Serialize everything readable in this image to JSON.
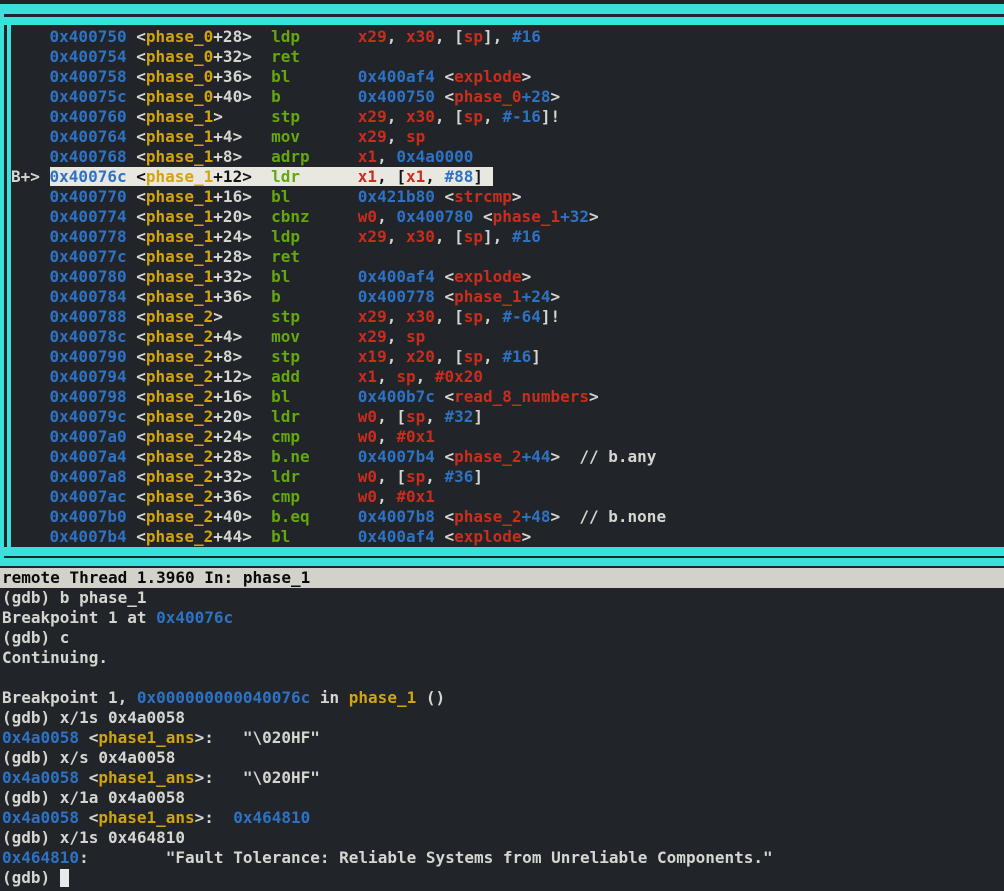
{
  "palette": {
    "background": "#212429",
    "border_cyan": "#38e1d9",
    "text_plain": "#d6d6d1",
    "text_address_blue": "#2e72c4",
    "text_symbol_gold": "#d2a40e",
    "text_mnemonic_green": "#63a80d",
    "text_register_red": "#c92d1d",
    "current_line_bg": "#e8e8e1",
    "status_bar_bg": "#d2d2cb",
    "status_bar_fg": "#0a0a0a"
  },
  "disasm_window": {
    "breakpoint_marker": "B+>",
    "rows": [
      {
        "addr": "0x400750",
        "sym": "phase_0",
        "off": "+28",
        "mnemonic": "ldp",
        "operands": [
          [
            "x29",
            "r"
          ],
          [
            ", ",
            "p"
          ],
          [
            "x30",
            "r"
          ],
          [
            ", [",
            "p"
          ],
          [
            "sp",
            "r"
          ],
          [
            "], ",
            "p"
          ],
          [
            "#16",
            "b"
          ]
        ]
      },
      {
        "addr": "0x400754",
        "sym": "phase_0",
        "off": "+32",
        "mnemonic": "ret",
        "operands": []
      },
      {
        "addr": "0x400758",
        "sym": "phase_0",
        "off": "+36",
        "mnemonic": "bl",
        "operands": [
          [
            "0x400af4",
            "b"
          ],
          [
            " <",
            "p"
          ],
          [
            "explode",
            "r"
          ],
          [
            ">",
            "p"
          ]
        ]
      },
      {
        "addr": "0x40075c",
        "sym": "phase_0",
        "off": "+40",
        "mnemonic": "b",
        "operands": [
          [
            "0x400750",
            "b"
          ],
          [
            " <",
            "p"
          ],
          [
            "phase_0",
            "r"
          ],
          [
            "+28",
            "b"
          ],
          [
            ">",
            "p"
          ]
        ]
      },
      {
        "addr": "0x400760",
        "sym": "phase_1",
        "off": "",
        "mnemonic": "stp",
        "operands": [
          [
            "x29",
            "r"
          ],
          [
            ", ",
            "p"
          ],
          [
            "x30",
            "r"
          ],
          [
            ", [",
            "p"
          ],
          [
            "sp",
            "r"
          ],
          [
            ", ",
            "p"
          ],
          [
            "#-16",
            "b"
          ],
          [
            "]!",
            "p"
          ]
        ]
      },
      {
        "addr": "0x400764",
        "sym": "phase_1",
        "off": "+4",
        "mnemonic": "mov",
        "operands": [
          [
            "x29",
            "r"
          ],
          [
            ", ",
            "p"
          ],
          [
            "sp",
            "r"
          ]
        ]
      },
      {
        "addr": "0x400768",
        "sym": "phase_1",
        "off": "+8",
        "mnemonic": "adrp",
        "operands": [
          [
            "x1",
            "r"
          ],
          [
            ", ",
            "p"
          ],
          [
            "0x4a0000",
            "b"
          ]
        ]
      },
      {
        "addr": "0x40076c",
        "sym": "phase_1",
        "off": "+12",
        "mnemonic": "ldr",
        "current": true,
        "operands": [
          [
            "x1",
            "r"
          ],
          [
            ", [",
            "p"
          ],
          [
            "x1",
            "r"
          ],
          [
            ", ",
            "p"
          ],
          [
            "#88",
            "b"
          ],
          [
            "]",
            "p"
          ]
        ]
      },
      {
        "addr": "0x400770",
        "sym": "phase_1",
        "off": "+16",
        "mnemonic": "bl",
        "operands": [
          [
            "0x421b80",
            "b"
          ],
          [
            " <",
            "p"
          ],
          [
            "strcmp",
            "r"
          ],
          [
            ">",
            "p"
          ]
        ]
      },
      {
        "addr": "0x400774",
        "sym": "phase_1",
        "off": "+20",
        "mnemonic": "cbnz",
        "operands": [
          [
            "w0",
            "r"
          ],
          [
            ", ",
            "p"
          ],
          [
            "0x400780",
            "b"
          ],
          [
            " <",
            "p"
          ],
          [
            "phase_1",
            "r"
          ],
          [
            "+32",
            "b"
          ],
          [
            ">",
            "p"
          ]
        ]
      },
      {
        "addr": "0x400778",
        "sym": "phase_1",
        "off": "+24",
        "mnemonic": "ldp",
        "operands": [
          [
            "x29",
            "r"
          ],
          [
            ", ",
            "p"
          ],
          [
            "x30",
            "r"
          ],
          [
            ", [",
            "p"
          ],
          [
            "sp",
            "r"
          ],
          [
            "], ",
            "p"
          ],
          [
            "#16",
            "b"
          ]
        ]
      },
      {
        "addr": "0x40077c",
        "sym": "phase_1",
        "off": "+28",
        "mnemonic": "ret",
        "operands": []
      },
      {
        "addr": "0x400780",
        "sym": "phase_1",
        "off": "+32",
        "mnemonic": "bl",
        "operands": [
          [
            "0x400af4",
            "b"
          ],
          [
            " <",
            "p"
          ],
          [
            "explode",
            "r"
          ],
          [
            ">",
            "p"
          ]
        ]
      },
      {
        "addr": "0x400784",
        "sym": "phase_1",
        "off": "+36",
        "mnemonic": "b",
        "operands": [
          [
            "0x400778",
            "b"
          ],
          [
            " <",
            "p"
          ],
          [
            "phase_1",
            "r"
          ],
          [
            "+24",
            "b"
          ],
          [
            ">",
            "p"
          ]
        ]
      },
      {
        "addr": "0x400788",
        "sym": "phase_2",
        "off": "",
        "mnemonic": "stp",
        "operands": [
          [
            "x29",
            "r"
          ],
          [
            ", ",
            "p"
          ],
          [
            "x30",
            "r"
          ],
          [
            ", [",
            "p"
          ],
          [
            "sp",
            "r"
          ],
          [
            ", ",
            "p"
          ],
          [
            "#-64",
            "b"
          ],
          [
            "]!",
            "p"
          ]
        ]
      },
      {
        "addr": "0x40078c",
        "sym": "phase_2",
        "off": "+4",
        "mnemonic": "mov",
        "operands": [
          [
            "x29",
            "r"
          ],
          [
            ", ",
            "p"
          ],
          [
            "sp",
            "r"
          ]
        ]
      },
      {
        "addr": "0x400790",
        "sym": "phase_2",
        "off": "+8",
        "mnemonic": "stp",
        "operands": [
          [
            "x19",
            "r"
          ],
          [
            ", ",
            "p"
          ],
          [
            "x20",
            "r"
          ],
          [
            ", [",
            "p"
          ],
          [
            "sp",
            "r"
          ],
          [
            ", ",
            "p"
          ],
          [
            "#16",
            "b"
          ],
          [
            "]",
            "p"
          ]
        ]
      },
      {
        "addr": "0x400794",
        "sym": "phase_2",
        "off": "+12",
        "mnemonic": "add",
        "operands": [
          [
            "x1",
            "r"
          ],
          [
            ", ",
            "p"
          ],
          [
            "sp",
            "r"
          ],
          [
            ", ",
            "p"
          ],
          [
            "#0x20",
            "r"
          ]
        ]
      },
      {
        "addr": "0x400798",
        "sym": "phase_2",
        "off": "+16",
        "mnemonic": "bl",
        "operands": [
          [
            "0x400b7c",
            "b"
          ],
          [
            " <",
            "p"
          ],
          [
            "read_8_numbers",
            "r"
          ],
          [
            ">",
            "p"
          ]
        ]
      },
      {
        "addr": "0x40079c",
        "sym": "phase_2",
        "off": "+20",
        "mnemonic": "ldr",
        "operands": [
          [
            "w0",
            "r"
          ],
          [
            ", [",
            "p"
          ],
          [
            "sp",
            "r"
          ],
          [
            ", ",
            "p"
          ],
          [
            "#32",
            "b"
          ],
          [
            "]",
            "p"
          ]
        ]
      },
      {
        "addr": "0x4007a0",
        "sym": "phase_2",
        "off": "+24",
        "mnemonic": "cmp",
        "operands": [
          [
            "w0",
            "r"
          ],
          [
            ", ",
            "p"
          ],
          [
            "#0x1",
            "r"
          ]
        ]
      },
      {
        "addr": "0x4007a4",
        "sym": "phase_2",
        "off": "+28",
        "mnemonic": "b.ne",
        "operands": [
          [
            "0x4007b4",
            "b"
          ],
          [
            " <",
            "p"
          ],
          [
            "phase_2",
            "r"
          ],
          [
            "+44",
            "b"
          ],
          [
            ">",
            "p"
          ],
          [
            "  // b.any",
            "p"
          ]
        ]
      },
      {
        "addr": "0x4007a8",
        "sym": "phase_2",
        "off": "+32",
        "mnemonic": "ldr",
        "operands": [
          [
            "w0",
            "r"
          ],
          [
            ", [",
            "p"
          ],
          [
            "sp",
            "r"
          ],
          [
            ", ",
            "p"
          ],
          [
            "#36",
            "b"
          ],
          [
            "]",
            "p"
          ]
        ]
      },
      {
        "addr": "0x4007ac",
        "sym": "phase_2",
        "off": "+36",
        "mnemonic": "cmp",
        "operands": [
          [
            "w0",
            "r"
          ],
          [
            ", ",
            "p"
          ],
          [
            "#0x1",
            "r"
          ]
        ]
      },
      {
        "addr": "0x4007b0",
        "sym": "phase_2",
        "off": "+40",
        "mnemonic": "b.eq",
        "operands": [
          [
            "0x4007b8",
            "b"
          ],
          [
            " <",
            "p"
          ],
          [
            "phase_2",
            "r"
          ],
          [
            "+48",
            "b"
          ],
          [
            ">",
            "p"
          ],
          [
            "  // b.none",
            "p"
          ]
        ]
      },
      {
        "addr": "0x4007b4",
        "sym": "phase_2",
        "off": "+44",
        "mnemonic": "bl",
        "operands": [
          [
            "0x400af4",
            "b"
          ],
          [
            " <",
            "p"
          ],
          [
            "explode",
            "r"
          ],
          [
            ">",
            "p"
          ]
        ]
      }
    ]
  },
  "status_bar": {
    "text": "remote Thread 1.3960 In: phase_1"
  },
  "console": {
    "lines": [
      [
        [
          "(gdb) b phase_1",
          "p"
        ]
      ],
      [
        [
          "Breakpoint 1 at ",
          "p"
        ],
        [
          "0x40076c",
          "b"
        ]
      ],
      [
        [
          "(gdb) c",
          "p"
        ]
      ],
      [
        [
          "Continuing.",
          "p"
        ]
      ],
      [],
      [
        [
          "Breakpoint 1, ",
          "p"
        ],
        [
          "0x000000000040076c",
          "b"
        ],
        [
          " in ",
          "p"
        ],
        [
          "phase_1",
          "y"
        ],
        [
          " ()",
          "p"
        ]
      ],
      [
        [
          "(gdb) x/1s 0x4a0058",
          "p"
        ]
      ],
      [
        [
          "0x4a0058",
          "b"
        ],
        [
          " <",
          "p"
        ],
        [
          "phase1_ans",
          "y"
        ],
        [
          ">:",
          "p"
        ],
        [
          "   \"\\020HF\"",
          "p"
        ]
      ],
      [
        [
          "(gdb) x/s 0x4a0058",
          "p"
        ]
      ],
      [
        [
          "0x4a0058",
          "b"
        ],
        [
          " <",
          "p"
        ],
        [
          "phase1_ans",
          "y"
        ],
        [
          ">:",
          "p"
        ],
        [
          "   \"\\020HF\"",
          "p"
        ]
      ],
      [
        [
          "(gdb) x/1a 0x4a0058",
          "p"
        ]
      ],
      [
        [
          "0x4a0058",
          "b"
        ],
        [
          " <",
          "p"
        ],
        [
          "phase1_ans",
          "y"
        ],
        [
          ">:",
          "p"
        ],
        [
          "  ",
          "p"
        ],
        [
          "0x464810",
          "b"
        ]
      ],
      [
        [
          "(gdb) x/1s 0x464810",
          "p"
        ]
      ],
      [
        [
          "0x464810",
          "b"
        ],
        [
          ":",
          "p"
        ],
        [
          "        \"Fault Tolerance: Reliable Systems from Unreliable Components.\"",
          "p"
        ]
      ],
      [
        [
          "(gdb) ",
          "p"
        ],
        [
          "",
          "cursor"
        ]
      ]
    ]
  }
}
